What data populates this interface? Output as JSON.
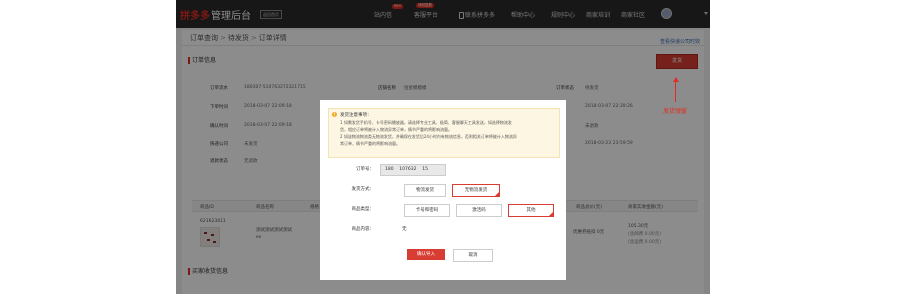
{
  "header": {
    "logo_brand": "拼多多",
    "logo_sub": "管理后台",
    "back_home": "返回首页",
    "nav": [
      {
        "label": "站内信",
        "badge": "99+"
      },
      {
        "label": "客服平台",
        "badge": "待回复数"
      },
      {
        "label": "联系拼多多"
      },
      {
        "label": "帮助中心"
      },
      {
        "label": "规则中心"
      },
      {
        "label": "商家培训"
      },
      {
        "label": "商家社区"
      }
    ]
  },
  "breadcrumb": [
    "订单查询",
    "待发货",
    "订单详情"
  ],
  "help_link": "查看快递公司时效",
  "order_section": {
    "title": "订单信息",
    "ship_button": "发货",
    "fields": [
      {
        "label": "订单流水",
        "value": "180307-510763272321715"
      },
      {
        "label": "店铺名称",
        "value": "恒星模模模"
      },
      {
        "label": "订单状态",
        "value": "待发货"
      },
      {
        "label": "下单时间",
        "value": "2018-03-07 22:09:18"
      },
      {
        "label": "确认时间",
        "value": "2018-03-07 22:09:18"
      },
      {
        "label": "快递公司",
        "value": "未发货"
      },
      {
        "label": "退款状态",
        "value": "无退款"
      },
      {
        "label": "time1",
        "value": "2018-03-07 22:39:26"
      },
      {
        "label": "售后状态",
        "value": "未退款"
      },
      {
        "label": "time2",
        "value": "2018-03-23 23:59:59"
      }
    ]
  },
  "goods_table": {
    "headers": [
      "商品ID",
      "商品名称",
      "规格",
      "商品总价(元)",
      "商家实收金额(元)"
    ],
    "row": {
      "id": "621623411",
      "name_line1": "测试测试测试测试",
      "name_line2": "ex",
      "discount": "优惠券抵扣 0元",
      "amount": "105.30元",
      "note1": "(含邮费 0.00元)",
      "note2": "(含运费 0.00元)"
    }
  },
  "buyer_section": {
    "title": "买家收货信息"
  },
  "annotation": "发货弹窗",
  "modal": {
    "notice_title": "发货注意事项：",
    "notice_lines": [
      "1 如需发货手机号、卡号密码播放器，请选择专业工具、极简、客服聊天工具发送，如选择物流发",
      "货，相应订单将被计入物流异常订单，情节严重的将影响流量。",
      "2 如该物流物流类无物流发货，并确保在发货后24小时内有物流信息，否则相关订单将被计入物流异",
      "常订单，情节严重的将影响流量。"
    ],
    "order_no_label": "订单号：",
    "order_no_value": "180    107632    15",
    "ship_method_label": "发货方式：",
    "ship_methods": [
      {
        "label": "物流发货",
        "selected": false
      },
      {
        "label": "无物流发货",
        "selected": true
      }
    ],
    "goods_type_label": "商品类型：",
    "goods_types": [
      {
        "label": "卡号和密码",
        "selected": false
      },
      {
        "label": "激活码",
        "selected": false
      },
      {
        "label": "其他",
        "selected": true
      }
    ],
    "content_label": "商品内容：",
    "content_value": "无",
    "confirm": "确认导入",
    "cancel": "取消"
  },
  "colors": {
    "accent": "#d73d32",
    "nav_bg": "#2b2b2b",
    "notice_bg": "#fdf6e3"
  }
}
